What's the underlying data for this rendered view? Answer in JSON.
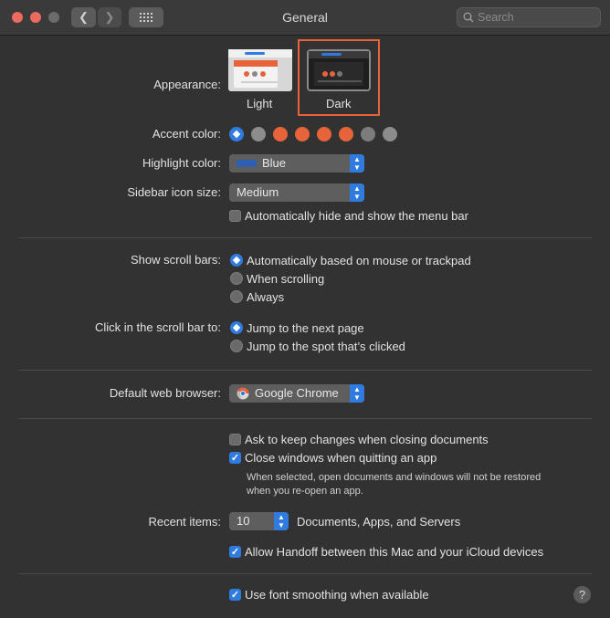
{
  "window": {
    "title": "General",
    "search_placeholder": "Search",
    "traffic_lights": [
      "#ec6a5e",
      "#f4bf4f",
      "#6c6c6c"
    ]
  },
  "appearance": {
    "label": "Appearance:",
    "options": [
      {
        "label": "Light",
        "selected": false
      },
      {
        "label": "Dark",
        "selected": true
      }
    ],
    "highlight_box_color": "#e8633a"
  },
  "accent_color": {
    "label": "Accent color:",
    "swatches": [
      "#2f7be0",
      "#8c8c8c",
      "#e7643a",
      "#e7643a",
      "#e7643a",
      "#e7643a",
      "#7c7c7c",
      "#8c8c8c"
    ]
  },
  "highlight_color": {
    "label": "Highlight color:",
    "value": "Blue",
    "swatch": "#2f5fb0"
  },
  "sidebar_icon_size": {
    "label": "Sidebar icon size:",
    "value": "Medium"
  },
  "menu_bar": {
    "label": "Automatically hide and show the menu bar",
    "checked": false
  },
  "scroll_bars": {
    "label": "Show scroll bars:",
    "options": [
      {
        "label": "Automatically based on mouse or trackpad",
        "selected": true
      },
      {
        "label": "When scrolling",
        "selected": false
      },
      {
        "label": "Always",
        "selected": false
      }
    ]
  },
  "click_scroll": {
    "label": "Click in the scroll bar to:",
    "options": [
      {
        "label": "Jump to the next page",
        "selected": true
      },
      {
        "label": "Jump to the spot that’s clicked",
        "selected": false
      }
    ]
  },
  "browser": {
    "label": "Default web browser:",
    "value": "Google Chrome"
  },
  "documents": {
    "ask_keep_changes": {
      "label": "Ask to keep changes when closing documents",
      "checked": false
    },
    "close_windows": {
      "label": "Close windows when quitting an app",
      "checked": true
    },
    "note_line1": "When selected, open documents and windows will not be restored",
    "note_line2": "when you re-open an app."
  },
  "recent_items": {
    "label": "Recent items:",
    "value": "10",
    "suffix": "Documents, Apps, and Servers"
  },
  "handoff": {
    "label": "Allow Handoff between this Mac and your iCloud devices",
    "checked": true
  },
  "font_smoothing": {
    "label": "Use font smoothing when available",
    "checked": true
  },
  "help": "?"
}
